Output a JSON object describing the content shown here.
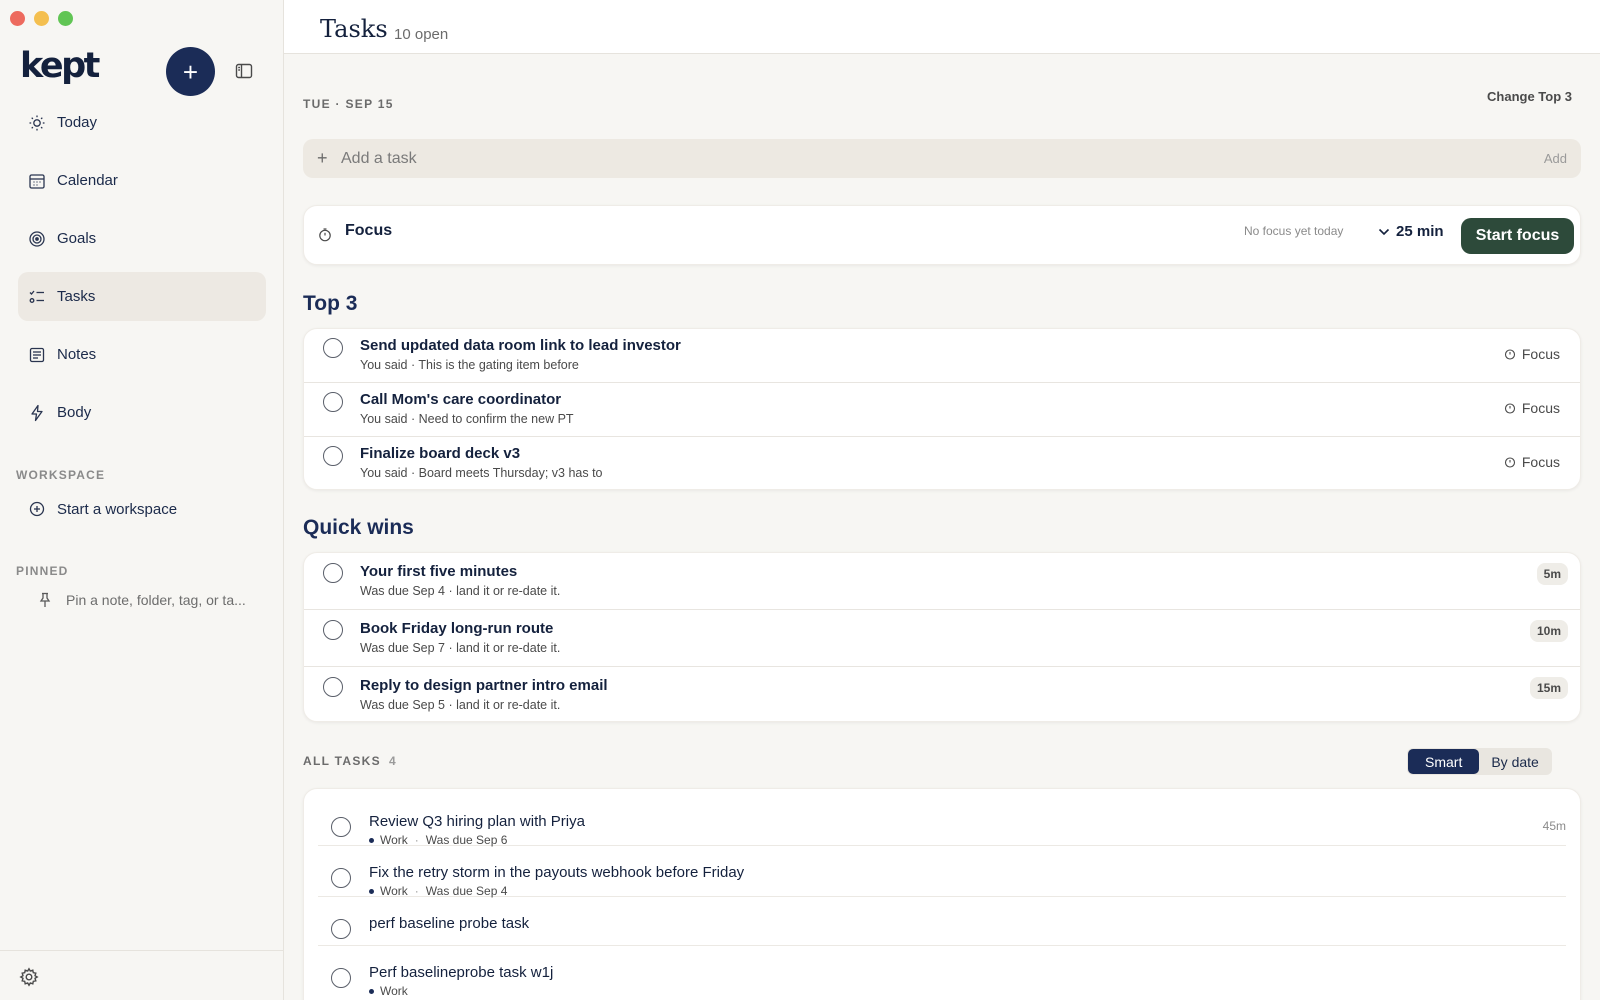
{
  "app": {
    "logo": "kept",
    "new_button": "+"
  },
  "sidebar": {
    "items": [
      {
        "label": "Today",
        "icon": "sun-icon",
        "active": false
      },
      {
        "label": "Calendar",
        "icon": "calendar-icon",
        "active": false
      },
      {
        "label": "Goals",
        "icon": "target-icon",
        "active": false
      },
      {
        "label": "Tasks",
        "icon": "checklist-icon",
        "active": true
      },
      {
        "label": "Notes",
        "icon": "notes-icon",
        "active": false
      },
      {
        "label": "Body",
        "icon": "bolt-icon",
        "active": false
      }
    ],
    "workspace_label": "WORKSPACE",
    "workspace_item": "Start a workspace",
    "pinned_label": "PINNED",
    "pinned_placeholder": "Pin a note, folder, tag, or ta..."
  },
  "header": {
    "title": "Tasks",
    "open_count": "10 open"
  },
  "day": {
    "date_label": "TUE · SEP 15",
    "change_top": "Change Top 3"
  },
  "add_task": {
    "plus": "+",
    "placeholder": "Add a task",
    "add_label": "Add"
  },
  "focus": {
    "title": "Focus",
    "status": "No focus yet today",
    "duration": "25 min",
    "start_label": "Start focus"
  },
  "top3": {
    "heading": "Top 3",
    "focus_label": "Focus",
    "tasks": [
      {
        "title": "Send updated data room link to lead investor",
        "sub": "You said · This is the gating item before"
      },
      {
        "title": "Call Mom's care coordinator",
        "sub": "You said · Need to confirm the new PT"
      },
      {
        "title": "Finalize board deck v3",
        "sub": "You said · Board meets Thursday; v3 has to"
      }
    ]
  },
  "quick_wins": {
    "heading": "Quick wins",
    "tasks": [
      {
        "title": "Your first five minutes",
        "sub": "Was due Sep 4 · land it or re-date it.",
        "est": "5m"
      },
      {
        "title": "Book Friday long-run route",
        "sub": "Was due Sep 7 · land it or re-date it.",
        "est": "10m"
      },
      {
        "title": "Reply to design partner intro email",
        "sub": "Was due Sep 5 · land it or re-date it.",
        "est": "15m"
      }
    ]
  },
  "all_tasks": {
    "label": "ALL TASKS",
    "count": "4",
    "sort_options": [
      "Smart",
      "By date"
    ],
    "sort_selected": "Smart",
    "tasks": [
      {
        "title": "Review Q3 hiring plan with Priya",
        "tag": "Work",
        "due": "Was due Sep 6",
        "est": "45m"
      },
      {
        "title": "Fix the retry storm in the payouts webhook before Friday",
        "tag": "Work",
        "due": "Was due Sep 4",
        "est": ""
      },
      {
        "title": "perf baseline probe task",
        "tag": "",
        "due": "",
        "est": ""
      },
      {
        "title": "Perf baselineprobe task w1j",
        "tag": "Work",
        "due": "",
        "est": ""
      }
    ]
  },
  "colors": {
    "accent": "#1b2c57",
    "focus_button": "#2d4a3a",
    "sidebar_bg": "#f7f6f3"
  }
}
